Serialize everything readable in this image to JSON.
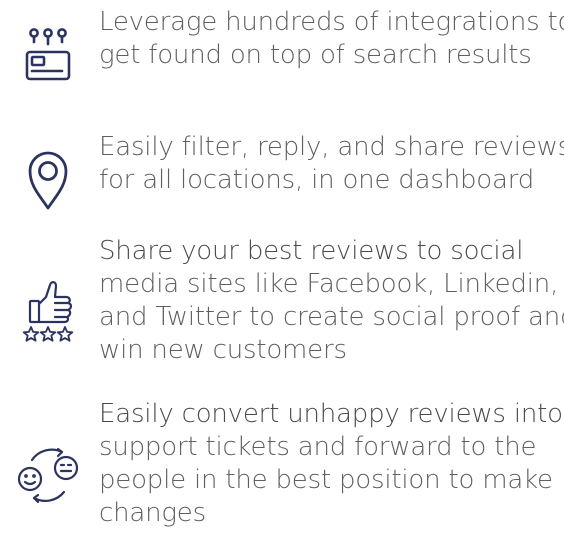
{
  "colors": {
    "icon": "#2c3360",
    "text": "#5f5f5f"
  },
  "features": [
    {
      "icon": "integrations-icon",
      "lines": [
        "Leverage hundreds of integrations to",
        "get found on top of search results"
      ]
    },
    {
      "icon": "location-pin-icon",
      "lines": [
        "Easily filter, reply, and share reviews,",
        "for all locations, in one dashboard"
      ]
    },
    {
      "icon": "thumbs-up-stars-icon",
      "lines": [
        "Share your best reviews to social",
        "media sites like Facebook, Linkedin,",
        "and Twitter to create social proof and",
        "win new customers"
      ]
    },
    {
      "icon": "unhappy-to-happy-cycle-icon",
      "lines": [
        "Easily convert unhappy reviews into",
        "support tickets and forward to the",
        "people in the best position to make",
        "changes"
      ]
    }
  ]
}
